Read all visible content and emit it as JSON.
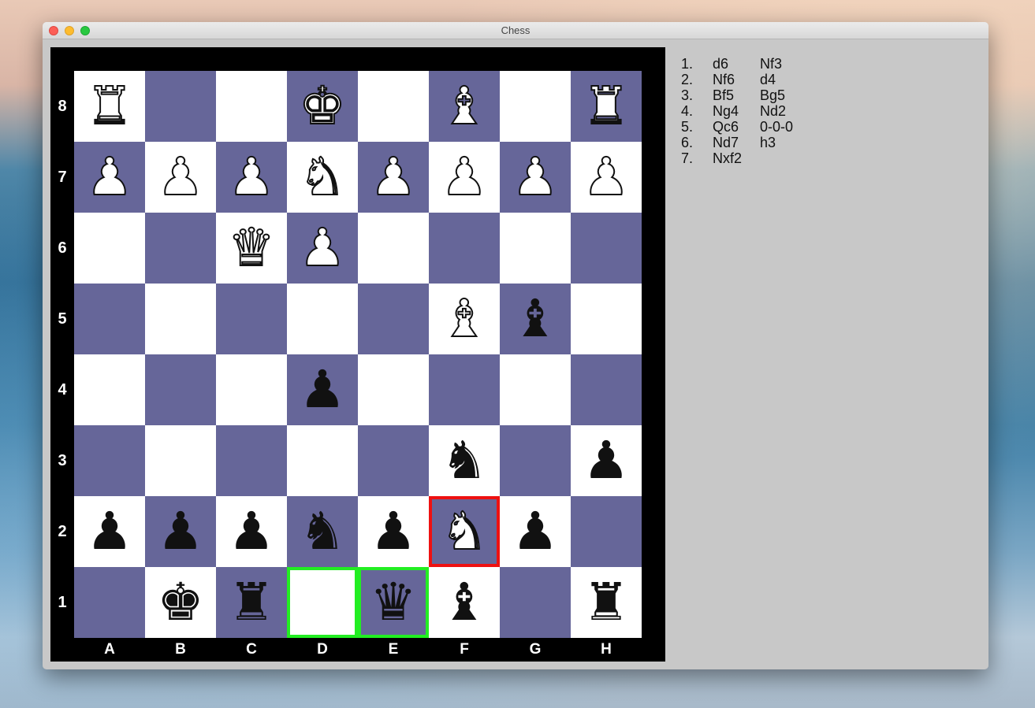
{
  "window": {
    "title": "Chess"
  },
  "colors": {
    "light_square": "#ffffff",
    "dark_square": "#666699",
    "frame": "#000000",
    "highlight_green": "#22ee22",
    "highlight_red": "#ee1111",
    "panel": "#c8c8c8"
  },
  "board": {
    "files": [
      "A",
      "B",
      "C",
      "D",
      "E",
      "F",
      "G",
      "H"
    ],
    "ranks": [
      "8",
      "7",
      "6",
      "5",
      "4",
      "3",
      "2",
      "1"
    ],
    "pieces": {
      "a8": "white-rook",
      "d8": "white-king",
      "f8": "white-bishop",
      "h8": "white-rook",
      "a7": "white-pawn",
      "b7": "white-pawn",
      "c7": "white-pawn",
      "d7": "white-knight",
      "e7": "white-pawn",
      "f7": "white-pawn",
      "g7": "white-pawn",
      "h7": "white-pawn",
      "c6": "white-queen",
      "d6": "white-pawn",
      "f5": "white-bishop",
      "g5": "black-bishop",
      "d4": "black-pawn",
      "f3": "black-knight",
      "h3": "black-pawn",
      "a2": "black-pawn",
      "b2": "black-pawn",
      "c2": "black-pawn",
      "d2": "black-knight",
      "e2": "black-pawn",
      "f2": "white-knight",
      "g2": "black-pawn",
      "b1": "black-king",
      "c1": "black-rook",
      "e1": "black-queen",
      "f1": "black-bishop",
      "h1": "black-rook"
    },
    "highlights": {
      "d1": "green",
      "e1": "green",
      "f2": "red"
    }
  },
  "moves": [
    {
      "num": "1.",
      "white": "d6",
      "black": "Nf3"
    },
    {
      "num": "2.",
      "white": "Nf6",
      "black": "d4"
    },
    {
      "num": "3.",
      "white": "Bf5",
      "black": "Bg5"
    },
    {
      "num": "4.",
      "white": "Ng4",
      "black": "Nd2"
    },
    {
      "num": "5.",
      "white": "Qc6",
      "black": "0-0-0"
    },
    {
      "num": "6.",
      "white": "Nd7",
      "black": "h3"
    },
    {
      "num": "7.",
      "white": "Nxf2",
      "black": ""
    }
  ]
}
